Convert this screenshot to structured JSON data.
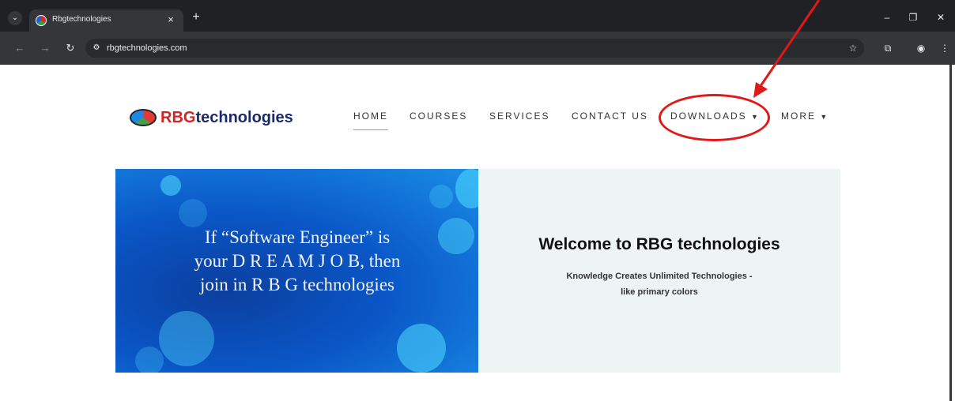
{
  "browser": {
    "tab_title": "Rbgtechnologies",
    "tab_close": "×",
    "new_tab": "+",
    "url": "rbgtechnologies.com",
    "window_controls": {
      "minimize": "–",
      "restore": "❐",
      "close": "✕"
    }
  },
  "site": {
    "logo_text_red": "RBG",
    "logo_text_rest": " technologies",
    "nav": [
      {
        "label": "HOME"
      },
      {
        "label": "COURSES"
      },
      {
        "label": "SERVICES"
      },
      {
        "label": "CONTACT US"
      },
      {
        "label": "DOWNLOADS",
        "caret": "▼"
      },
      {
        "label": "MORE",
        "caret": "▼"
      }
    ],
    "hero": {
      "tagline_line1": "If “Software Engineer” is",
      "tagline_line2": "your D R E A M J O B, then",
      "tagline_line3": "join in R B G technologies",
      "welcome_title": "Welcome to RBG technologies",
      "welcome_sub_line1": "Knowledge Creates Unlimited Technologies -",
      "welcome_sub_line2": "like primary colors"
    }
  },
  "annotation": {
    "color": "#e01818"
  },
  "icons": [
    "tab-search-icon",
    "favicon-icon",
    "close-icon",
    "plus-icon",
    "back-icon",
    "forward-icon",
    "reload-icon",
    "site-info-icon",
    "star-icon",
    "extensions-icon",
    "profile-icon",
    "menu-icon"
  ]
}
